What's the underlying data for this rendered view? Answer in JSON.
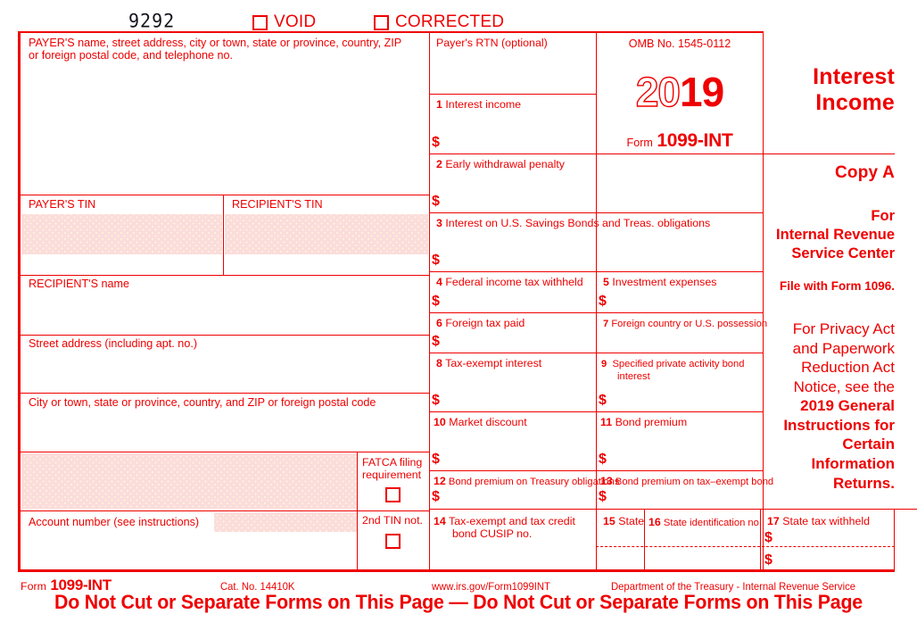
{
  "form": {
    "number_stamp": "9292",
    "void_label": "VOID",
    "corrected_label": "CORRECTED",
    "title_line1": "Interest",
    "title_line2": "Income",
    "omb": "OMB No. 1545-0112",
    "year_hollow": "20",
    "year_solid": "19",
    "form_word": "Form",
    "form_name": "1099-INT",
    "accent_red": "#ef0000",
    "shade_pink": "#fbdcdc"
  },
  "right_column": {
    "copy": "Copy A",
    "for": "For",
    "irs_line1": "Internal Revenue",
    "irs_line2": "Service Center",
    "file_with": "File with Form 1096.",
    "privacy_line1": "For Privacy Act",
    "privacy_line2": "and Paperwork",
    "privacy_line3": "Reduction Act",
    "privacy_line4": "Notice, see the",
    "privacy_bold1": "2019 General",
    "privacy_bold2": "Instructions for",
    "privacy_bold3": "Certain",
    "privacy_bold4": "Information",
    "privacy_bold5": "Returns."
  },
  "left_fields": {
    "payer_name": "PAYER'S name, street address, city or town, state or province, country, ZIP or foreign postal code, and telephone no.",
    "payer_tin": "PAYER'S TIN",
    "recipient_tin": "RECIPIENT'S TIN",
    "recipient_name": "RECIPIENT'S name",
    "street_address": "Street address (including apt. no.)",
    "city_state_zip": "City or town, state or province, country, and ZIP or foreign postal code",
    "fatca_line1": "FATCA filing",
    "fatca_line2": "requirement",
    "account_number": "Account number (see instructions)",
    "second_tin": "2nd TIN not."
  },
  "boxes": {
    "rtn": {
      "label": "Payer's RTN (optional)"
    },
    "b1": {
      "num": "1",
      "label": "Interest income",
      "dollar": "$"
    },
    "b2": {
      "num": "2",
      "label": "Early withdrawal penalty",
      "dollar": "$"
    },
    "b3": {
      "num": "3",
      "label": "Interest on U.S. Savings Bonds and Treas. obligations",
      "dollar": "$"
    },
    "b4": {
      "num": "4",
      "label": "Federal income tax withheld",
      "dollar": "$"
    },
    "b5": {
      "num": "5",
      "label": "Investment expenses",
      "dollar": "$"
    },
    "b6": {
      "num": "6",
      "label": "Foreign tax paid",
      "dollar": "$"
    },
    "b7": {
      "num": "7",
      "label": "Foreign country or U.S. possession"
    },
    "b8": {
      "num": "8",
      "label": "Tax-exempt interest",
      "dollar": "$"
    },
    "b9": {
      "num": "9",
      "label_line1": "Specified private activity bond",
      "label_line2": "interest",
      "dollar": "$"
    },
    "b10": {
      "num": "10",
      "label": "Market discount",
      "dollar": "$"
    },
    "b11": {
      "num": "11",
      "label": "Bond premium",
      "dollar": "$"
    },
    "b12": {
      "num": "12",
      "label": "Bond premium on Treasury obligations",
      "dollar": "$"
    },
    "b13": {
      "num": "13",
      "label": "Bond premium on tax–exempt bond",
      "dollar": "$"
    },
    "b14": {
      "num": "14",
      "label_line1": "Tax-exempt and tax credit",
      "label_line2": "bond CUSIP no."
    },
    "b15": {
      "num": "15",
      "label": "State"
    },
    "b16": {
      "num": "16",
      "label": "State identification no."
    },
    "b17": {
      "num": "17",
      "label": "State tax withheld",
      "dollar1": "$",
      "dollar2": "$"
    }
  },
  "footer": {
    "form_word": "Form",
    "form_name": "1099-INT",
    "cat_no": "Cat. No. 14410K",
    "url": "www.irs.gov/Form1099INT",
    "treasury": "Department of the Treasury - Internal Revenue Service",
    "do_not_cut": "Do Not Cut or Separate Forms on This Page  —  Do Not Cut or Separate Forms on This Page"
  }
}
